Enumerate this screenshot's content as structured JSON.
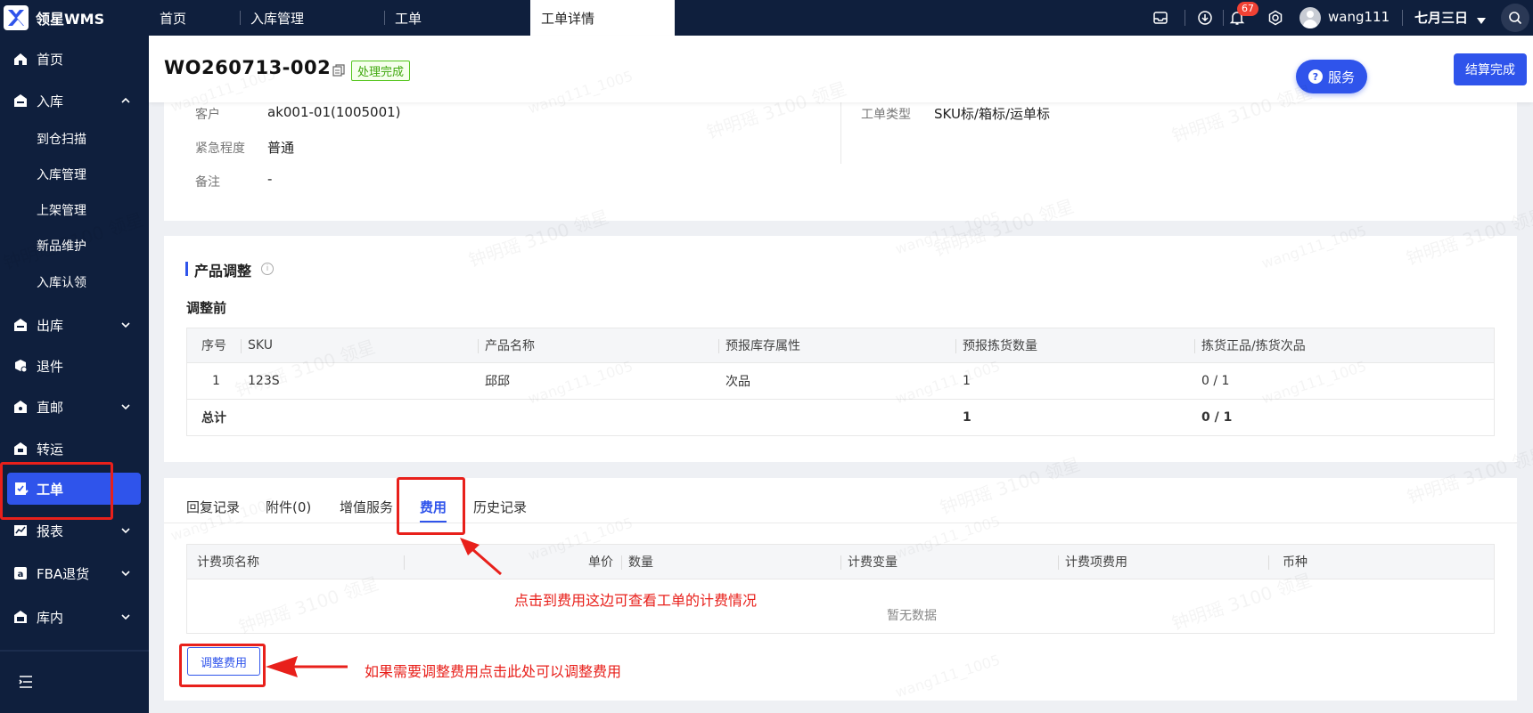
{
  "app": {
    "name": "领星WMS"
  },
  "top_tabs": [
    "首页",
    "入库管理",
    "工单",
    "工单详情"
  ],
  "topbar": {
    "notification_count": "67",
    "username": "wang111",
    "date_label": "七月三日"
  },
  "sidebar": {
    "items": [
      {
        "label": "首页",
        "icon": "home-icon"
      },
      {
        "label": "入库",
        "icon": "inbound-icon"
      },
      {
        "label": "出库",
        "icon": "outbound-icon"
      },
      {
        "label": "退件",
        "icon": "return-icon"
      },
      {
        "label": "直邮",
        "icon": "direct-mail-icon"
      },
      {
        "label": "转运",
        "icon": "transfer-icon"
      },
      {
        "label": "工单",
        "icon": "work-order-icon"
      },
      {
        "label": "报表",
        "icon": "report-icon"
      },
      {
        "label": "FBA退货",
        "icon": "fba-return-icon"
      },
      {
        "label": "库内",
        "icon": "warehouse-icon"
      }
    ],
    "sub_items": [
      "到仓扫描",
      "入库管理",
      "上架管理",
      "新品维护",
      "入库认领"
    ]
  },
  "header": {
    "work_order_no": "WO260713-002",
    "status": "处理完成",
    "service_label": "服务",
    "settle_label": "结算完成"
  },
  "info": {
    "customer_label": "客户",
    "customer_value": "ak001-01(1005001)",
    "urgency_label": "紧急程度",
    "urgency_value": "普通",
    "remark_label": "备注",
    "remark_value": "-",
    "type_label": "工单类型",
    "type_value": "SKU标/箱标/运单标"
  },
  "product": {
    "title": "产品调整",
    "before_label": "调整前",
    "columns": [
      "序号",
      "SKU",
      "产品名称",
      "预报库存属性",
      "预报拣货数量",
      "拣货正品/拣货次品"
    ],
    "rows": [
      {
        "index": "1",
        "sku": "123S",
        "name": "邱邱",
        "attr": "次品",
        "qty": "1",
        "picked": "0 / 1"
      }
    ],
    "total": {
      "label": "总计",
      "qty": "1",
      "picked": "0 / 1"
    }
  },
  "tabs": [
    "回复记录",
    "附件(0)",
    "增值服务",
    "费用",
    "历史记录"
  ],
  "fee_table": {
    "columns": [
      "计费项名称",
      "单价",
      "数量",
      "计费变量",
      "计费项费用",
      "币种"
    ],
    "empty": "暂无数据"
  },
  "adjust_button": "调整费用",
  "annotations": {
    "fee_tab_note": "点击到费用这边可查看工单的计费情况",
    "adjust_note": "如果需要调整费用点击此处可以调整费用"
  },
  "watermark": {
    "text1": "钟明瑶 3100 领星",
    "text2": "wang111_1005"
  },
  "colors": {
    "sidebar_bg": "#0f1f3d",
    "accent": "#2f54eb",
    "annotation_red": "#e8201b",
    "status_green": "#52c41a"
  }
}
